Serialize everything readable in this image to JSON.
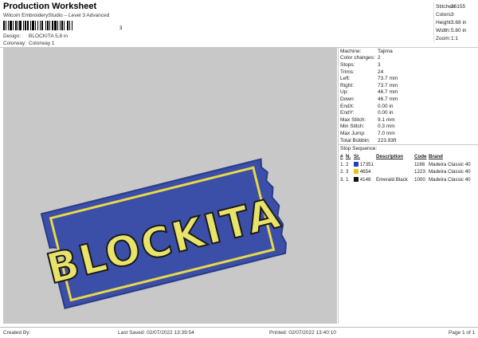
{
  "header": {
    "title": "Production Worksheet",
    "subtitle": "Wilcom EmbroideryStudio – Level 3 Advanced",
    "barcode_digit": "3",
    "design_label": "Design:",
    "design_value": "BLOCKITA 5,8 in",
    "colorway_label": "Colorway:",
    "colorway_value": "Colorway 1"
  },
  "summary": [
    {
      "label": "Stitches:",
      "value": "26155"
    },
    {
      "label": "Colors:",
      "value": "3"
    },
    {
      "label": "Height:",
      "value": "3.68 in"
    },
    {
      "label": "Width:",
      "value": "5.80 in"
    },
    {
      "label": "Zoom:",
      "value": "1:1"
    }
  ],
  "design": {
    "text": "BLOCKITA",
    "colors": {
      "ticket_fill": "#3b4fa8",
      "ticket_edge": "#2a3b88",
      "stripe": "#e8d84a",
      "letter_fill": "#e9e36a",
      "letter_outline": "#1a1a1a",
      "background": "#c8c8c8"
    }
  },
  "details": [
    {
      "label": "Machine:",
      "value": "Tajima"
    },
    {
      "label": "Color changes:",
      "value": "2"
    },
    {
      "label": "Stops:",
      "value": "3"
    },
    {
      "label": "Trims:",
      "value": "24"
    },
    {
      "label": "Left:",
      "value": "73.7 mm"
    },
    {
      "label": "Right:",
      "value": "73.7 mm"
    },
    {
      "label": "Up:",
      "value": "46.7 mm"
    },
    {
      "label": "Down:",
      "value": "46.7 mm"
    },
    {
      "label": "EndX:",
      "value": "0.00 in"
    },
    {
      "label": "EndY:",
      "value": "0.00 in"
    },
    {
      "label": "Max Stitch:",
      "value": "9.1 mm"
    },
    {
      "label": "Min Stitch:",
      "value": "0.3 mm"
    },
    {
      "label": "Max Jump:",
      "value": "7.0 mm"
    },
    {
      "label": "Total Bobbin:",
      "value": "223.93ft"
    }
  ],
  "stop_sequence": {
    "title": "Stop Sequence:",
    "headers": [
      "#",
      "N.",
      "St.",
      "Description",
      "Code",
      "Brand"
    ],
    "rows": [
      {
        "num": "1.",
        "n": "2",
        "color": "#1f3fbf",
        "st": "17351",
        "desc": "",
        "code": "1166",
        "brand": "Madeira Classic 40"
      },
      {
        "num": "2.",
        "n": "3",
        "color": "#e8c21a",
        "st": "4654",
        "desc": "",
        "code": "1223",
        "brand": "Madeira Classic 40"
      },
      {
        "num": "3.",
        "n": "1",
        "color": "#111111",
        "st": "4148",
        "desc": "Emerald Black",
        "code": "1000",
        "brand": "Madeira Classic 40"
      }
    ]
  },
  "footer": {
    "created_by": "Created By:",
    "last_saved": "Last Saved: 02/07/2022 13:39:54",
    "printed": "Printed: 02/07/2022 13:40:10",
    "page": "Page 1 of 1"
  }
}
